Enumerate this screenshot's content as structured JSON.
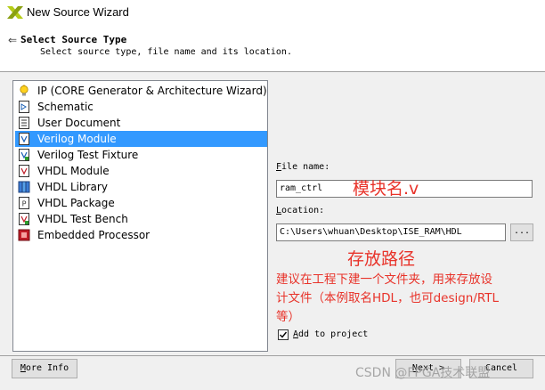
{
  "window": {
    "title": "New Source Wizard"
  },
  "header": {
    "back_glyph": "⇐",
    "title": "Select Source Type",
    "subtitle": "Select source type, file name and its location."
  },
  "source_types": [
    {
      "label": "IP (CORE Generator & Architecture Wizard)",
      "icon": "ip-bulb-icon",
      "selected": false
    },
    {
      "label": "Schematic",
      "icon": "schematic-icon",
      "selected": false
    },
    {
      "label": "User Document",
      "icon": "document-icon",
      "selected": false
    },
    {
      "label": "Verilog Module",
      "icon": "verilog-module-icon",
      "selected": true
    },
    {
      "label": "Verilog Test Fixture",
      "icon": "verilog-test-icon",
      "selected": false
    },
    {
      "label": "VHDL Module",
      "icon": "vhdl-module-icon",
      "selected": false
    },
    {
      "label": "VHDL Library",
      "icon": "vhdl-library-icon",
      "selected": false
    },
    {
      "label": "VHDL Package",
      "icon": "vhdl-package-icon",
      "selected": false
    },
    {
      "label": "VHDL Test Bench",
      "icon": "vhdl-testbench-icon",
      "selected": false
    },
    {
      "label": "Embedded Processor",
      "icon": "embedded-processor-icon",
      "selected": false
    }
  ],
  "file_name": {
    "label_u": "F",
    "label_rest": "ile name:",
    "value": "ram_ctrl"
  },
  "location": {
    "label_u": "L",
    "label_rest": "ocation:",
    "value": "C:\\Users\\whuan\\Desktop\\ISE_RAM\\HDL",
    "browse_label": "..."
  },
  "annotations": {
    "module_name": "模块名.v",
    "store_path": "存放路径",
    "suggestion_line1": "建议在工程下建一个文件夹，用来存放设",
    "suggestion_line2": "计文件（本例取名HDL，也可design/RTL",
    "suggestion_line3": "等）"
  },
  "add_to_project": {
    "label_u": "A",
    "label_rest": "dd to project",
    "checked": true
  },
  "buttons": {
    "more_info": {
      "u": "M",
      "rest": "ore Info"
    },
    "next": {
      "u": "N",
      "rest": "ext >"
    },
    "cancel": "Cancel"
  },
  "watermark": "CSDN @FPGA技术联盟",
  "colors": {
    "selection": "#3399ff",
    "annotation_red": "#e8332a",
    "title_accent": "#b5cc18"
  }
}
